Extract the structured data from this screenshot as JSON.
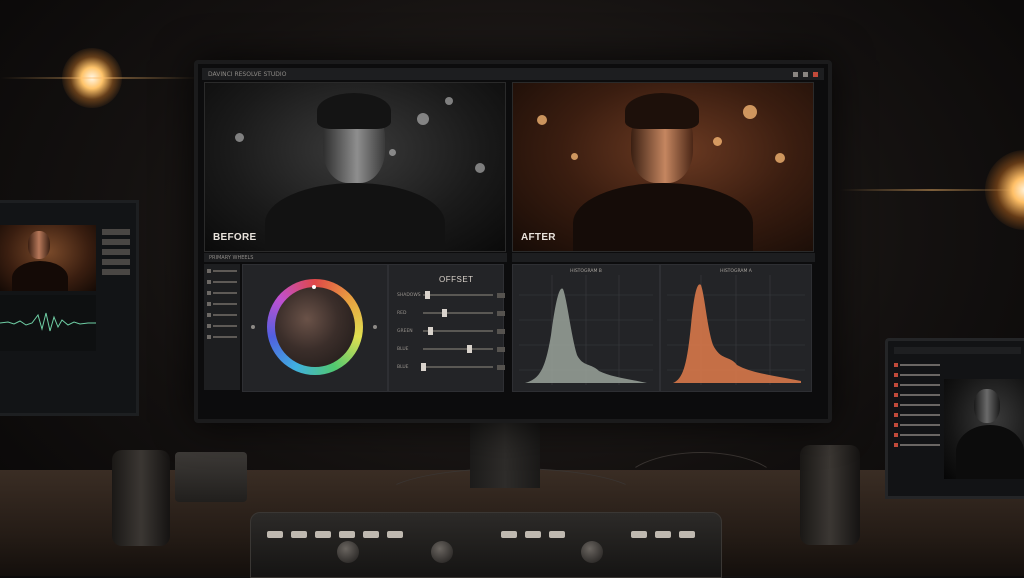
{
  "main_monitor": {
    "window_title": "DAVINCI RESOLVE STUDIO",
    "before_label": "BEFORE",
    "after_label": "AFTER",
    "color_panel_header": "PRIMARY WHEELS",
    "offset_panel": {
      "title": "OFFSET",
      "sliders": [
        {
          "label": "SHADOWS",
          "value": 0.05
        },
        {
          "label": "RED",
          "value": 0.3
        },
        {
          "label": "GREEN",
          "value": 0.1
        },
        {
          "label": "BLUE",
          "value": 0.65
        },
        {
          "label": "BLUE",
          "value": 0.0
        }
      ]
    },
    "scope_before_title": "HISTOGRAM B",
    "scope_after_title": "HISTOGRAM A"
  },
  "colors": {
    "accent_warm": "#d98a4e",
    "scope_before_fill": "#9aa39b",
    "scope_after_fill": "#d7784a",
    "record_red": "#c24a3a"
  },
  "icons": [
    "window-close-icon",
    "window-minimize-icon",
    "color-wheel-icon",
    "reset-icon"
  ]
}
